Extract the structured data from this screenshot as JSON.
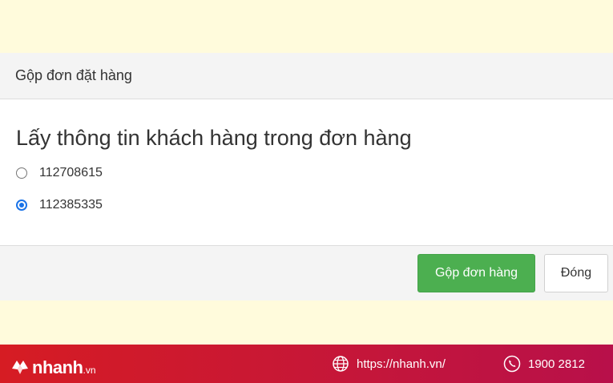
{
  "modal": {
    "title": "Gộp đơn đặt hàng",
    "heading": "Lấy thông tin khách hàng trong đơn hàng",
    "options": [
      {
        "label": "112708615",
        "checked": false
      },
      {
        "label": "112385335",
        "checked": true
      }
    ],
    "merge_button": "Gộp đơn hàng",
    "close_button": "Đóng"
  },
  "footer": {
    "brand": "nhanh",
    "brand_suffix": ".vn",
    "website": "https://nhanh.vn/",
    "hotline": "1900 2812"
  },
  "colors": {
    "primary_button": "#4caf50",
    "radio_checked": "#1a73e8",
    "footer_bar": "#d61c23",
    "page_background": "#fffbdc"
  }
}
